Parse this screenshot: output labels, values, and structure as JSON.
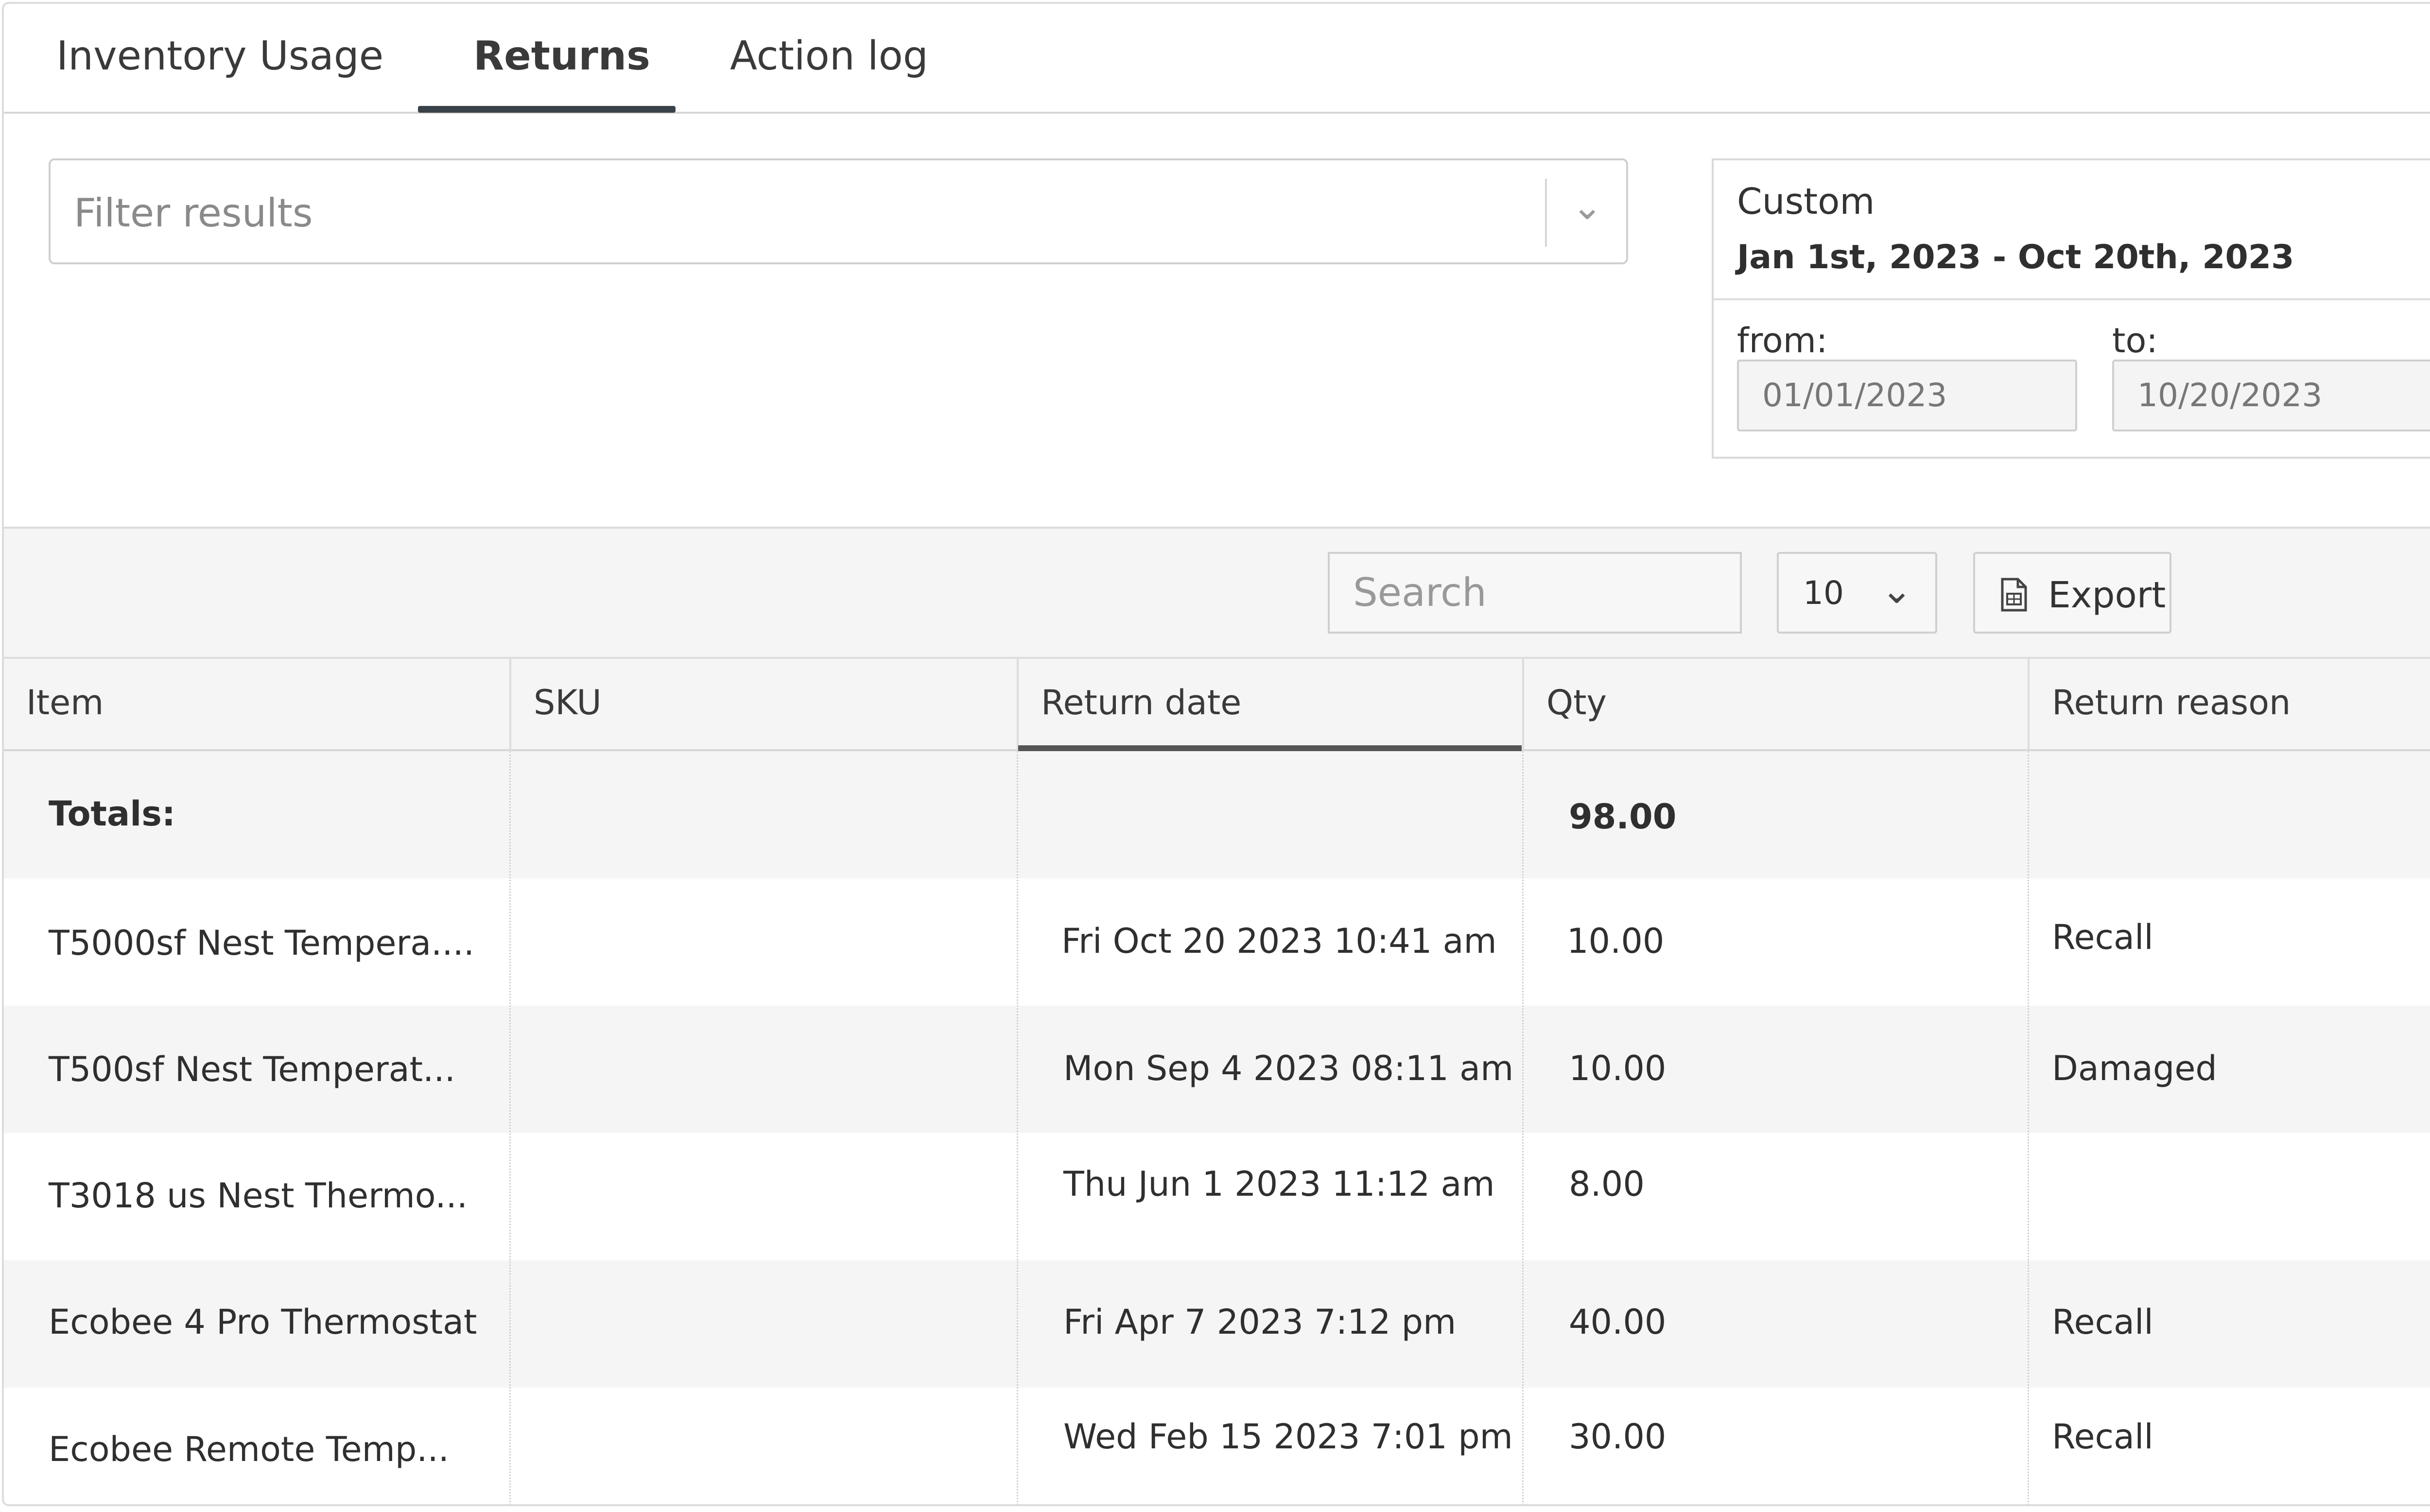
{
  "tabs": [
    {
      "label": "Inventory Usage",
      "active": false
    },
    {
      "label": "Returns",
      "active": true
    },
    {
      "label": "Action log",
      "active": false
    }
  ],
  "filter": {
    "placeholder": "Filter results",
    "icon": "chevron-down-icon"
  },
  "date_range": {
    "preset": "Custom",
    "summary": "Jan 1st, 2023 - Oct 20th, 2023",
    "from_label": "from:",
    "from_value": "01/01/2023",
    "to_label": "to:",
    "to_value": "10/20/2023"
  },
  "toolbar": {
    "search_placeholder": "Search",
    "page_size": "10",
    "export_label": "Export",
    "export_icon": "spreadsheet-icon"
  },
  "table": {
    "columns": [
      "Item",
      "SKU",
      "Return date",
      "Qty",
      "Return reason"
    ],
    "sorted_column": "Return date",
    "totals": {
      "label": "Totals:",
      "qty": "98.00"
    },
    "rows": [
      {
        "item": "T5000sf Nest Tempera....",
        "sku": "",
        "return_date": "Fri Oct 20 2023 10:41 am",
        "qty": "10.00",
        "reason": "Recall"
      },
      {
        "item": "T500sf Nest Temperat...",
        "sku": "",
        "return_date": "Mon Sep 4 2023 08:11 am",
        "qty": "10.00",
        "reason": "Damaged"
      },
      {
        "item": "T3018 us Nest Thermo...",
        "sku": "",
        "return_date": "Thu Jun 1 2023 11:12 am",
        "qty": "8.00",
        "reason": ""
      },
      {
        "item": "Ecobee 4 Pro Thermostat",
        "sku": "",
        "return_date": "Fri Apr 7 2023 7:12 pm",
        "qty": "40.00",
        "reason": "Recall"
      },
      {
        "item": "Ecobee Remote Temp...",
        "sku": "",
        "return_date": "Wed Feb 15 2023 7:01 pm",
        "qty": "30.00",
        "reason": "Recall"
      }
    ]
  }
}
